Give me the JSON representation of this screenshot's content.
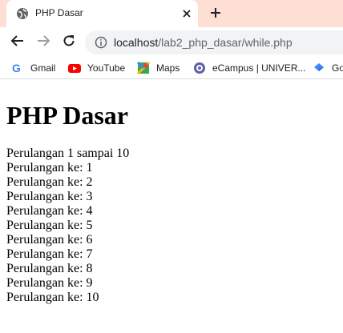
{
  "browser": {
    "tab_title": "PHP Dasar",
    "url_host": "localhost",
    "url_path": "/lab2_php_dasar/while.php",
    "bookmarks": [
      {
        "label": "Gmail",
        "icon": "gmail-icon"
      },
      {
        "label": "YouTube",
        "icon": "youtube-icon"
      },
      {
        "label": "Maps",
        "icon": "maps-icon"
      },
      {
        "label": "eCampus | UNIVER...",
        "icon": "ecampus-icon"
      },
      {
        "label": "Go",
        "icon": "google-bookmark-icon"
      }
    ]
  },
  "content": {
    "heading": "PHP Dasar",
    "intro": "Perulangan 1 sampai 10",
    "lines": [
      "Perulangan ke: 1",
      "Perulangan ke: 2",
      "Perulangan ke: 3",
      "Perulangan ke: 4",
      "Perulangan ke: 5",
      "Perulangan ke: 6",
      "Perulangan ke: 7",
      "Perulangan ke: 8",
      "Perulangan ke: 9",
      "Perulangan ke: 10"
    ]
  },
  "colors": {
    "tabstrip_bg": "#fde0d3",
    "omnibox_bg": "#f1f3f4",
    "youtube_red": "#ff0000"
  }
}
